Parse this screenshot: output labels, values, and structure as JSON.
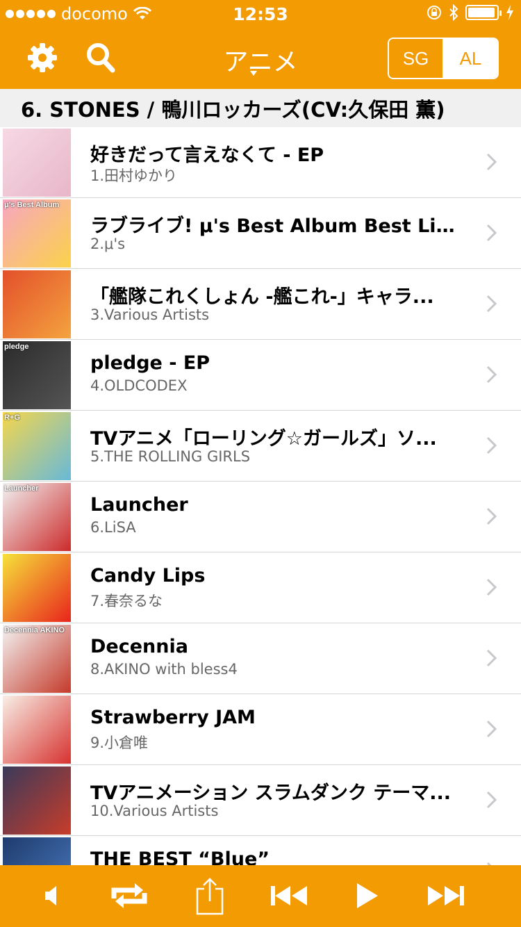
{
  "status_bar": {
    "carrier": "docomo",
    "time": "12:53",
    "battery_level": 0.95
  },
  "nav": {
    "title": "アニメ",
    "segment_sg": "SG",
    "segment_al": "AL",
    "selected_segment": "AL"
  },
  "now_playing_header": "6. STONES / 鴨川ロッカーズ(CV:久保田 薫)",
  "albums": [
    {
      "title": "好きだって言えなくて - EP",
      "subtitle": "1.田村ゆかり",
      "art_icon": "album-art-pink-portrait",
      "art_colors": [
        "#f6d9e4",
        "#e8b6c8"
      ]
    },
    {
      "title": "ラブライブ! μ's Best Album Best Live!...",
      "subtitle": "2.μ's",
      "art_icon": "album-art-group-collage",
      "art_colors": [
        "#f7a6c0",
        "#fbd24a"
      ],
      "art_text": "μ's Best Album"
    },
    {
      "title": "「艦隊これくしょん -艦これ-」キャラ...",
      "subtitle": "3.Various Artists",
      "art_icon": "album-art-anime-girls",
      "art_colors": [
        "#e3502b",
        "#f4a33e"
      ]
    },
    {
      "title": "pledge - EP",
      "subtitle": "4.OLDCODEX",
      "art_icon": "album-art-dark-scratch",
      "art_colors": [
        "#2b2b2b",
        "#555555"
      ],
      "art_text": "pledge"
    },
    {
      "title": "TVアニメ「ローリング☆ガールズ」ソ...",
      "subtitle": "5.THE ROLLING GIRLS",
      "art_icon": "album-art-anime-group",
      "art_colors": [
        "#f5d64c",
        "#67b9d9"
      ],
      "art_text": "R+G"
    },
    {
      "title": "Launcher",
      "subtitle": "6.LiSA",
      "art_icon": "album-art-launcher",
      "art_colors": [
        "#f2f2f2",
        "#cc2a2a"
      ],
      "art_text": "Launcher"
    },
    {
      "title": "Candy Lips",
      "subtitle": "7.春奈るな",
      "art_icon": "album-art-candy-balloons",
      "art_colors": [
        "#f6e23a",
        "#e8241c"
      ]
    },
    {
      "title": "Decennia",
      "subtitle": "8.AKINO with bless4",
      "art_icon": "album-art-decennia",
      "art_colors": [
        "#f4f4f4",
        "#c43a2a"
      ],
      "art_text": "Decennia AKINO"
    },
    {
      "title": "Strawberry JAM",
      "subtitle": "9.小倉唯",
      "art_icon": "album-art-strawberry",
      "art_colors": [
        "#f8efe6",
        "#d7322f"
      ]
    },
    {
      "title": "TVアニメーション スラムダンク テーマ...",
      "subtitle": "10.Various Artists",
      "art_icon": "album-art-slam-dunk",
      "art_colors": [
        "#3a3a5a",
        "#c83c2a"
      ]
    },
    {
      "title": "THE BEST “Blue”",
      "subtitle": "",
      "art_icon": "album-art-blue",
      "art_colors": [
        "#1f3b6e",
        "#4a7bbf"
      ]
    }
  ],
  "controls": {
    "volume": "volume-icon",
    "repeat": "repeat-icon",
    "share": "share-icon",
    "previous": "previous-track-icon",
    "play": "play-icon",
    "next": "next-track-icon"
  },
  "colors": {
    "accent": "#f29b02",
    "header_bg": "#f0f0f0",
    "subtitle": "#666666",
    "separator": "#d6d6d6"
  }
}
